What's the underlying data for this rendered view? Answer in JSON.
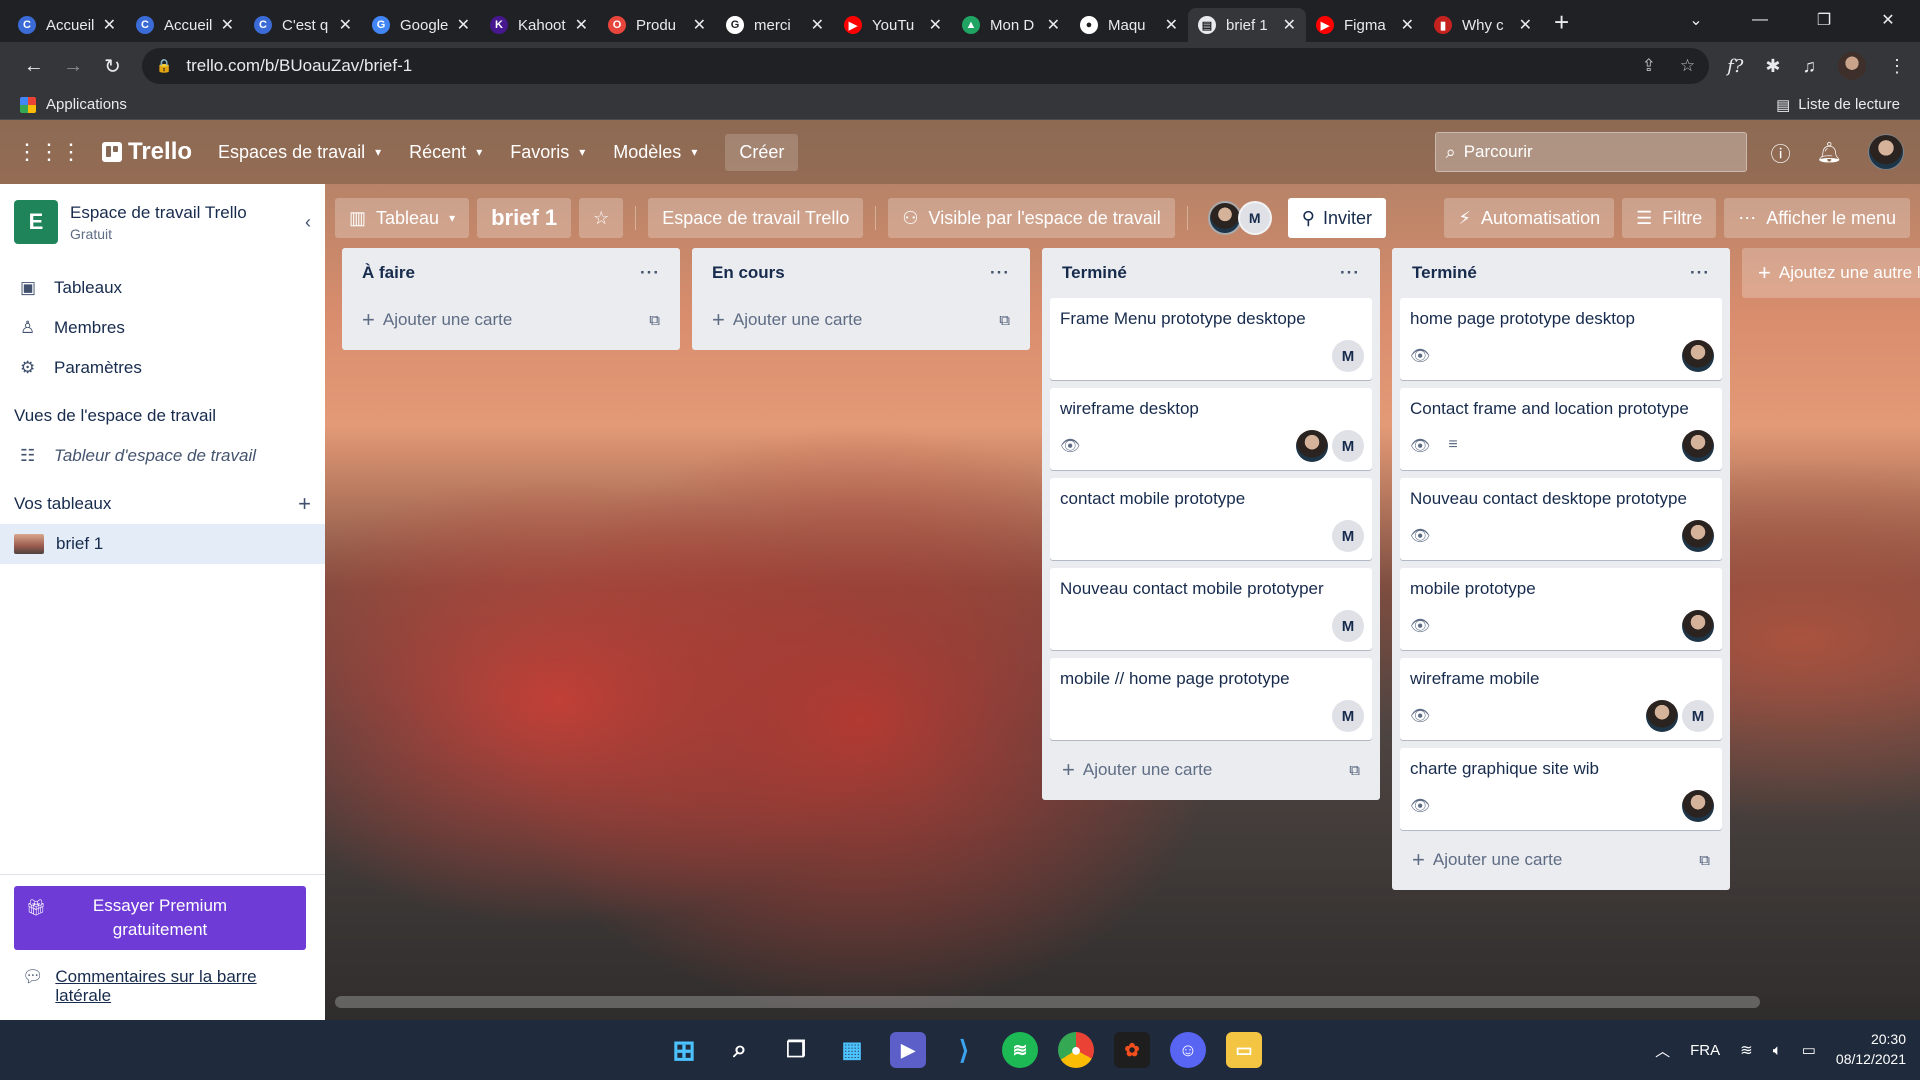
{
  "browser": {
    "tabs": [
      {
        "title": "Accueil",
        "color": "#3b6bd6",
        "glyph": "C"
      },
      {
        "title": "Accueil",
        "color": "#3b6bd6",
        "glyph": "C"
      },
      {
        "title": "C'est q",
        "color": "#3b6bd6",
        "glyph": "C"
      },
      {
        "title": "Google",
        "color": "#4285f4",
        "glyph": "G"
      },
      {
        "title": "Kahoot",
        "color": "#46178f",
        "glyph": "K"
      },
      {
        "title": "Produ",
        "color": "#e8453c",
        "glyph": "O"
      },
      {
        "title": "merci",
        "color": "#ffffff",
        "glyph": "G"
      },
      {
        "title": "YouTu",
        "color": "#ff0000",
        "glyph": "▶"
      },
      {
        "title": "Mon D",
        "color": "#1fa463",
        "glyph": "▲"
      },
      {
        "title": "Maqu",
        "color": "#ffffff",
        "glyph": "●"
      },
      {
        "title": "brief 1",
        "color": "#e8eaed",
        "glyph": "▤",
        "active": true
      },
      {
        "title": "Figma",
        "color": "#ff0000",
        "glyph": "▶"
      },
      {
        "title": "Why c",
        "color": "#c5221f",
        "glyph": "▮"
      }
    ],
    "url": "trello.com/b/BUoauZav/brief-1",
    "bookmarks_label": "Applications",
    "reading_list": "Liste de lecture"
  },
  "nav": {
    "logo": "Trello",
    "items": [
      "Espaces de travail",
      "Récent",
      "Favoris",
      "Modèles"
    ],
    "create": "Créer",
    "search_placeholder": "Parcourir"
  },
  "sidebar": {
    "badge": "E",
    "workspace": "Espace de travail Trello",
    "plan": "Gratuit",
    "items": [
      "Tableaux",
      "Membres",
      "Paramètres"
    ],
    "views_title": "Vues de l'espace de travail",
    "view_item": "Tableur d'espace de travail",
    "boards_title": "Vos tableaux",
    "board_item": "brief 1",
    "premium": "Essayer Premium gratuitement",
    "feedback": "Commentaires sur la barre latérale"
  },
  "board": {
    "view": "Tableau",
    "title": "brief 1",
    "workspace": "Espace de travail Trello",
    "visibility": "Visible par l'espace de travail",
    "member_letter": "M",
    "invite": "Inviter",
    "automation": "Automatisation",
    "filter": "Filtre",
    "menu": "Afficher le menu",
    "add_list": "Ajoutez une autre liste",
    "add_card": "Ajouter une carte"
  },
  "lists": [
    {
      "title": "À faire",
      "cards": []
    },
    {
      "title": "En cours",
      "cards": []
    },
    {
      "title": "Terminé",
      "cards": [
        {
          "title": "Frame Menu prototype desktope",
          "watch": false,
          "desc": false,
          "members": [
            "M"
          ]
        },
        {
          "title": "wireframe desktop",
          "watch": true,
          "desc": false,
          "members": [
            "photo",
            "M"
          ]
        },
        {
          "title": "contact mobile prototype",
          "watch": false,
          "desc": false,
          "members": [
            "M"
          ]
        },
        {
          "title": "Nouveau contact mobile prototyper",
          "watch": false,
          "desc": false,
          "members": [
            "M"
          ]
        },
        {
          "title": "mobile // home page prototype",
          "watch": false,
          "desc": false,
          "members": [
            "M"
          ]
        }
      ]
    },
    {
      "title": "Terminé",
      "cards": [
        {
          "title": "home page prototype desktop",
          "watch": true,
          "desc": false,
          "members": [
            "photo"
          ]
        },
        {
          "title": "Contact frame and location prototype",
          "watch": true,
          "desc": true,
          "members": [
            "photo"
          ]
        },
        {
          "title": "Nouveau contact desktope prototype",
          "watch": true,
          "desc": false,
          "members": [
            "photo"
          ]
        },
        {
          "title": "mobile prototype",
          "watch": true,
          "desc": false,
          "members": [
            "photo"
          ]
        },
        {
          "title": "wireframe mobile",
          "watch": true,
          "desc": false,
          "members": [
            "photo",
            "M"
          ]
        },
        {
          "title": "charte graphique site wib",
          "watch": true,
          "desc": false,
          "members": [
            "photo"
          ]
        }
      ]
    }
  ],
  "taskbar": {
    "lang": "FRA",
    "time": "20:30",
    "date": "08/12/2021"
  }
}
